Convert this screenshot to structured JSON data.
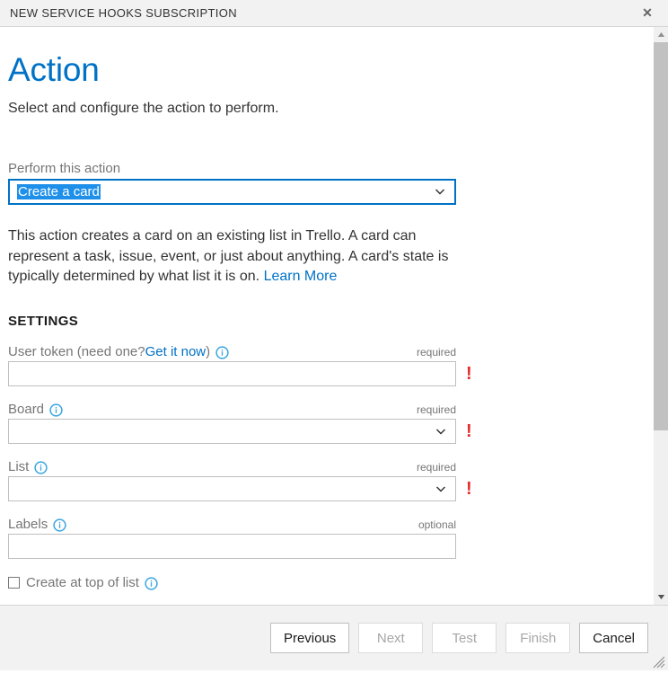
{
  "titlebar": {
    "title": "NEW SERVICE HOOKS SUBSCRIPTION",
    "close_label": "✕",
    "close_icon": "close-icon"
  },
  "page": {
    "title": "Action",
    "subtitle": "Select and configure the action to perform."
  },
  "action": {
    "label": "Perform this action",
    "selected": "Create a card",
    "chevron_icon": "chevron-down-icon",
    "description_part1": "This action creates a card on an existing list in Trello. A card can represent a task, issue, event, or just about anything. A card's state is typically determined by what list it is on. ",
    "learn_more": "Learn More"
  },
  "settings": {
    "heading": "SETTINGS",
    "fields": [
      {
        "name": "user-token",
        "label_pre": "User token (need one? ",
        "link": "Get it now",
        "label_post": ")",
        "requirement": "required",
        "type": "text",
        "value": "",
        "has_error": true,
        "info_icon": "info-icon"
      },
      {
        "name": "board",
        "label_pre": "Board",
        "link": "",
        "label_post": "",
        "requirement": "required",
        "type": "select",
        "value": "",
        "has_error": true,
        "info_icon": "info-icon"
      },
      {
        "name": "list",
        "label_pre": "List",
        "link": "",
        "label_post": "",
        "requirement": "required",
        "type": "select",
        "value": "",
        "has_error": true,
        "info_icon": "info-icon"
      },
      {
        "name": "labels",
        "label_pre": "Labels",
        "link": "",
        "label_post": "",
        "requirement": "optional",
        "type": "text",
        "value": "",
        "has_error": false,
        "info_icon": "info-icon"
      }
    ],
    "checkbox": {
      "label": "Create at top of list",
      "checked": false,
      "info_icon": "info-icon"
    }
  },
  "footer": {
    "buttons": [
      {
        "name": "previous",
        "label": "Previous",
        "disabled": false
      },
      {
        "name": "next",
        "label": "Next",
        "disabled": true
      },
      {
        "name": "test",
        "label": "Test",
        "disabled": true
      },
      {
        "name": "finish",
        "label": "Finish",
        "disabled": true
      },
      {
        "name": "cancel",
        "label": "Cancel",
        "disabled": false
      }
    ]
  },
  "scrollbar": {
    "up_arrow": "▲",
    "down_arrow": "▼",
    "thumb_position_pct": 0,
    "thumb_size_pct": 71
  },
  "colors": {
    "accent": "#0072c6",
    "selection": "#1e90ea",
    "error": "#e32b2b",
    "info": "#3aa5e0",
    "chrome": "#f2f2f2"
  }
}
